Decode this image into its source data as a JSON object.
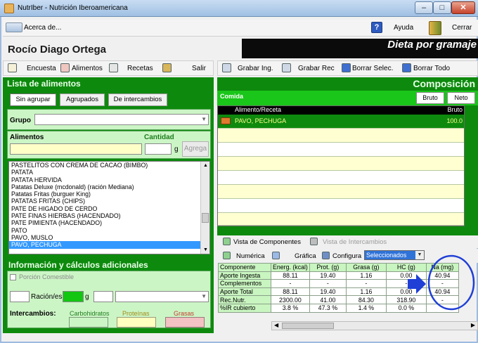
{
  "window": {
    "title": "NutrIber - Nutrición Iberoamericana"
  },
  "menubar": {
    "about": "Acerca de...",
    "help": "Ayuda",
    "close": "Cerrar"
  },
  "header": {
    "patient": "Rocío Diago Ortega",
    "mode": "Dieta por gramaje"
  },
  "left_toolbar": {
    "survey": "Encuesta",
    "foods": "Alimentos",
    "recipes": "Recetas",
    "exit": "Salir"
  },
  "right_toolbar": {
    "save_ing": "Grabar Ing.",
    "save_rec": "Grabar Rec",
    "delete_sel": "Borrar Selec.",
    "delete_all": "Borrar Todo"
  },
  "foods_panel": {
    "title": "Lista de alimentos",
    "tabs": [
      "Sin agrupar",
      "Agrupados",
      "De intercambios"
    ],
    "group_label": "Grupo",
    "foods_label": "Alimentos",
    "quantity_label": "Cantidad",
    "quantity_unit": "g",
    "add_button": "Agrega",
    "items": [
      "PASTELITOS CON CREMA DE CACAO (BIMBO)",
      "PATATA",
      "PATATA HERVIDA",
      "Patatas Deluxe (mcdonald) (ración Mediana)",
      "Patatas Fritas (burguer King)",
      "PATATAS FRITAS (CHIPS)",
      "PATE DE HIGADO DE CERDO",
      "PATE FINAS HIERBAS (HACENDADO)",
      "PATE PIMIENTA (HACENDADO)",
      "PATO",
      "PAVO, MUSLO",
      "PAVO, PECHUGA"
    ],
    "selected_item": "PAVO, PECHUGA"
  },
  "info_panel": {
    "title": "Información y cálculos adicionales",
    "edible_portion": "Porción Comestible",
    "ration_label": "Ración/es",
    "ration_unit": "g",
    "exchanges_label": "Intercambios:",
    "carbs": "Carbohidratos",
    "proteins": "Proteínas",
    "fats": "Grasas"
  },
  "composition": {
    "title": "Composición",
    "meal_label": "Comida",
    "raw_button": "Bruto",
    "net_button": "Neto",
    "grid_header": {
      "food": "Alimento/Receta",
      "raw": "Bruto"
    },
    "grid_rows": [
      {
        "food": "PAVO, PECHUGA",
        "raw": "100.0"
      }
    ]
  },
  "component_tabs": {
    "components_view": "Vista de Componentes",
    "exchanges_view": "Vista de Intercambios"
  },
  "component_toolbar": {
    "numeric": "Numérica",
    "graphic": "Gráfica",
    "configure": "Configura",
    "filter": "Seleccionados"
  },
  "components_table": {
    "headers": [
      "Componente",
      "Energ. (kcal)",
      "Prot. (g)",
      "Grasa (g)",
      "HC (g)",
      "Na (mg)"
    ],
    "rows": [
      [
        "Aporte Ingesta",
        "88.11",
        "19.40",
        "1.16",
        "0.00",
        "40.94"
      ],
      [
        "Complementos",
        "-",
        "-",
        "-",
        "-",
        "-"
      ],
      [
        "Aporte Total",
        "88.11",
        "19.40",
        "1.16",
        "0.00",
        "40.94"
      ],
      [
        "Rec.Nutr.",
        "2300.00",
        "41.00",
        "84.30",
        "318.90",
        "-"
      ],
      [
        "%IR cubierto",
        "3.8 %",
        "47.3 %",
        "1.4 %",
        "0.0 %",
        ""
      ]
    ]
  },
  "annotation_color": "#1f3fd6",
  "accent_green": "#0d8a0d"
}
